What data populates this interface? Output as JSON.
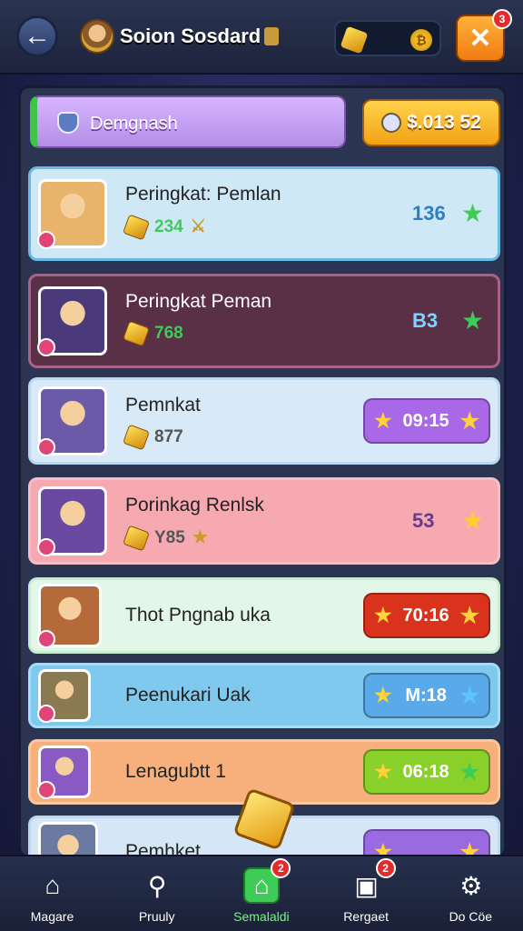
{
  "header": {
    "back_icon": "arrow-left-icon",
    "title": "Soion Sosdard",
    "currency_coin_symbol": "₿",
    "close_badge": "3",
    "close_symbol": "✕"
  },
  "filter": {
    "label": "Demgnash",
    "money": "$.013 52"
  },
  "rows": [
    {
      "name": "Peringkat: Pemlan",
      "sub_value": "234",
      "sub_suffix": "⚔",
      "score": "136",
      "bg": "#cfe8f6",
      "border": "#6ab9e6",
      "portrait_bg": "#e8b36a",
      "star_color": "#3ecb57"
    },
    {
      "name": "Peringkat Peman",
      "sub_value": "768",
      "sub_suffix": "",
      "score": "B3",
      "bg": "#5a3046",
      "border": "#a7628a",
      "portrait_bg": "#4b3a7a",
      "star_color": "#3ecb57"
    },
    {
      "name": "Pemnkat",
      "sub_value": "877",
      "sub_suffix": "",
      "score": "09:15",
      "bg": "#d8eaf7",
      "border": "#bcd8ee",
      "portrait_bg": "#6a5aa8",
      "star_color": "#ffd13a",
      "button_bg": "#a868e8"
    },
    {
      "name": "Porinkag Renlsk",
      "sub_value": "Y85",
      "sub_suffix": "★",
      "score": "53",
      "bg": "#f6a9b1",
      "border": "#f2bfc6",
      "portrait_bg": "#6a4aa0",
      "star_color": "#ffcf2e"
    },
    {
      "name": "Thot Pngnab uka",
      "sub_value": "",
      "sub_suffix": "",
      "score": "70:16",
      "bg": "#e3f7e8",
      "border": "#c8ecd2",
      "portrait_bg": "#b46a3a",
      "star_color": "#ffd13a",
      "button_bg": "#d9331e"
    },
    {
      "name": "Peenukari Uak",
      "sub_value": "",
      "sub_suffix": "",
      "score": "M:18",
      "bg": "#7fc9ee",
      "border": "#a6dcf5",
      "portrait_bg": "#8a7a52",
      "star_color": "#5ec3ff",
      "button_bg": "#5aa9e8"
    },
    {
      "name": "Lenagubtt 1",
      "sub_value": "",
      "sub_suffix": "",
      "score": "06:18",
      "bg": "#f7b07c",
      "border": "#f9c79e",
      "portrait_bg": "#8a5ac4",
      "star_color": "#3ecb57",
      "button_bg": "#8ad02b"
    },
    {
      "name": "Pemhket",
      "sub_value": "",
      "sub_suffix": "",
      "score": "",
      "bg": "#d5e6f6",
      "border": "#bcd8ee",
      "portrait_bg": "#6a7aa0",
      "star_color": "#ffd13a",
      "button_bg": "#9a6ae0"
    }
  ],
  "nav": [
    {
      "label": "Magare",
      "icon": "home-icon",
      "glyph": "⌂",
      "badge": ""
    },
    {
      "label": "Pruuly",
      "icon": "search-icon",
      "glyph": "⚲",
      "badge": ""
    },
    {
      "label": "Semalaldi",
      "icon": "house-gem-icon",
      "glyph": "⌂",
      "badge": "2",
      "active": true
    },
    {
      "label": "Rergaet",
      "icon": "box-icon",
      "glyph": "▣",
      "badge": "2"
    },
    {
      "label": "Do Cöe",
      "icon": "gear-icon",
      "glyph": "⚙",
      "badge": ""
    }
  ]
}
